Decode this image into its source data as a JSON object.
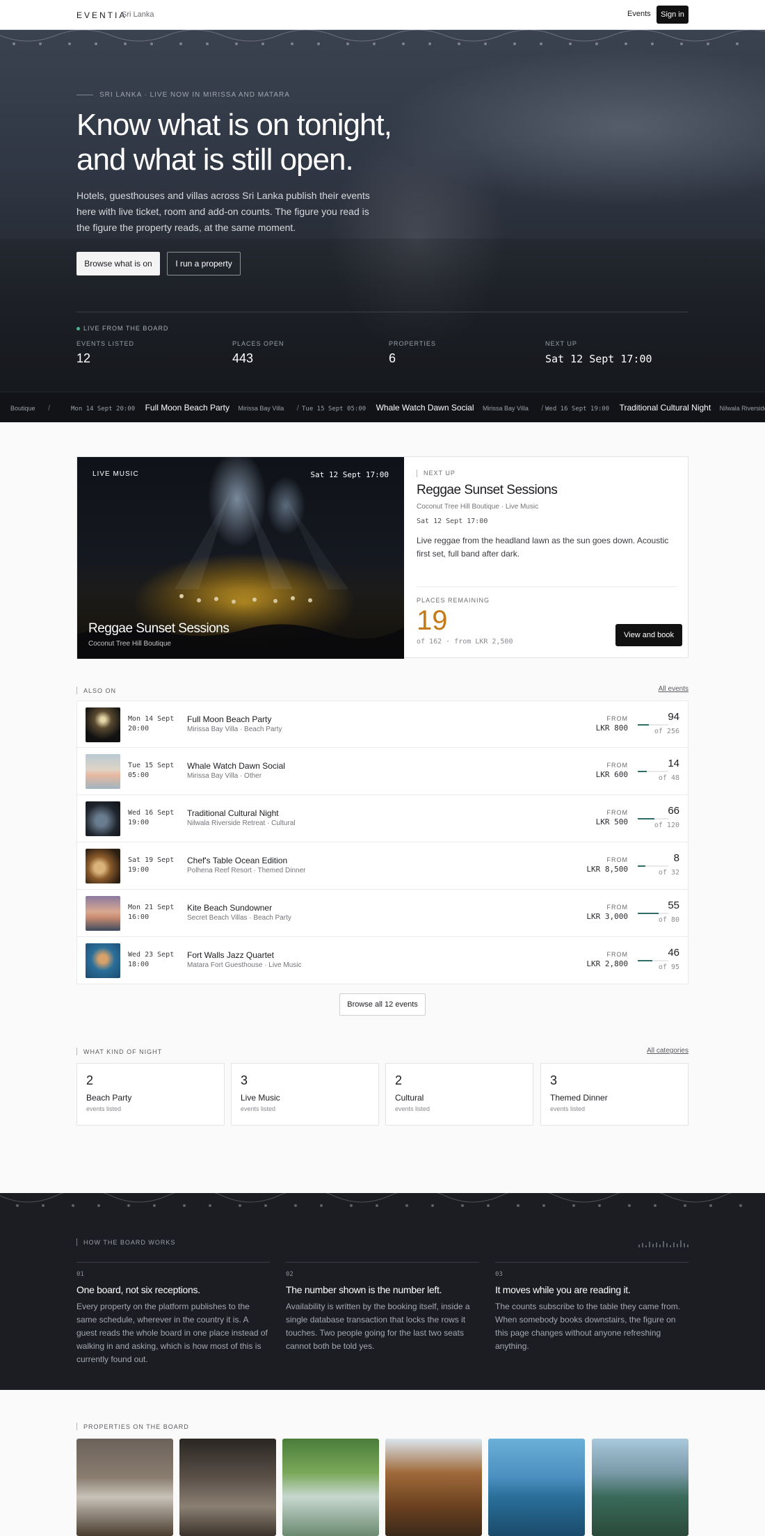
{
  "nav": {
    "brand": "EVENTIA",
    "brand_sub": "Sri Lanka",
    "events_link": "Events",
    "signin": "Sign in"
  },
  "hero": {
    "kicker": "SRI LANKA · LIVE NOW IN MIRISSA AND MATARA",
    "headline_line1": "Know what is on tonight,",
    "headline_line2": "and what is still open.",
    "lede": "Hotels, guesthouses and villas across Sri Lanka publish their events here with live ticket, room and add-on counts. The figure you read is the figure the property reads, at the same moment.",
    "primary_cta": "Browse what is on",
    "secondary_cta": "I run a property",
    "live_label": "LIVE FROM THE BOARD",
    "stats": [
      {
        "label": "EVENTS LISTED",
        "value": "12"
      },
      {
        "label": "PLACES OPEN",
        "value": "443"
      },
      {
        "label": "PROPERTIES",
        "value": "6"
      },
      {
        "label": "NEXT UP",
        "value": "Sat 12 Sept 17:00"
      }
    ],
    "ticker": [
      {
        "date": "",
        "name": "",
        "venue": "Boutique"
      },
      {
        "date": "Mon 14 Sept 20:00",
        "name": "Full Moon Beach Party",
        "venue": "Mirissa Bay Villa"
      },
      {
        "date": "Tue 15 Sept 05:00",
        "name": "Whale Watch Dawn Social",
        "venue": "Mirissa Bay Villa"
      },
      {
        "date": "Wed 16 Sept 19:00",
        "name": "Traditional Cultural Night",
        "venue": "Nilwala Riverside"
      }
    ]
  },
  "feature": {
    "tag": "LIVE MUSIC",
    "photo_time": "Sat 12 Sept 17:00",
    "photo_title": "Reggae Sunset Sessions",
    "photo_sub": "Coconut Tree Hill Boutique",
    "next_label": "NEXT UP",
    "title": "Reggae Sunset Sessions",
    "subtitle": "Coconut Tree Hill Boutique · Live Music",
    "time": "Sat 12 Sept 17:00",
    "description": "Live reggae from the headland lawn as the sun goes down. Acoustic first set, full band after dark.",
    "places_label": "PLACES REMAINING",
    "places_value": "19",
    "places_detail": "of 162 · from LKR 2,500",
    "book": "View and book"
  },
  "also_on": {
    "heading": "ALSO ON",
    "link": "All events",
    "rows": [
      {
        "day": "Mon 14 Sept",
        "time": "20:00",
        "name": "Full Moon Beach Party",
        "venue": "Mirissa Bay Villa · Beach Party",
        "from": "FROM",
        "price": "LKR 800",
        "left": "94",
        "of": "of 256",
        "fill": 0.37
      },
      {
        "day": "Tue 15 Sept",
        "time": "05:00",
        "name": "Whale Watch Dawn Social",
        "venue": "Mirissa Bay Villa · Other",
        "from": "FROM",
        "price": "LKR 600",
        "left": "14",
        "of": "of 48",
        "fill": 0.29
      },
      {
        "day": "Wed 16 Sept",
        "time": "19:00",
        "name": "Traditional Cultural Night",
        "venue": "Nilwala Riverside Retreat · Cultural",
        "from": "FROM",
        "price": "LKR 500",
        "left": "66",
        "of": "of 120",
        "fill": 0.55
      },
      {
        "day": "Sat 19 Sept",
        "time": "19:00",
        "name": "Chef's Table Ocean Edition",
        "venue": "Polhena Reef Resort · Themed Dinner",
        "from": "FROM",
        "price": "LKR 8,500",
        "left": "8",
        "of": "of 32",
        "fill": 0.25
      },
      {
        "day": "Mon 21 Sept",
        "time": "16:00",
        "name": "Kite Beach Sundowner",
        "venue": "Secret Beach Villas · Beach Party",
        "from": "FROM",
        "price": "LKR 3,000",
        "left": "55",
        "of": "of 80",
        "fill": 0.69
      },
      {
        "day": "Wed 23 Sept",
        "time": "18:00",
        "name": "Fort Walls Jazz Quartet",
        "venue": "Matara Fort Guesthouse · Live Music",
        "from": "FROM",
        "price": "LKR 2,800",
        "left": "46",
        "of": "of 95",
        "fill": 0.48
      }
    ],
    "browse_all": "Browse all 12 events"
  },
  "categories": {
    "heading": "WHAT KIND OF NIGHT",
    "link": "All categories",
    "items": [
      {
        "count": "2",
        "label": "Beach Party",
        "sub": "events listed"
      },
      {
        "count": "3",
        "label": "Live Music",
        "sub": "events listed"
      },
      {
        "count": "2",
        "label": "Cultural",
        "sub": "events listed"
      },
      {
        "count": "3",
        "label": "Themed Dinner",
        "sub": "events listed"
      }
    ]
  },
  "how": {
    "heading": "HOW THE BOARD WORKS",
    "steps": [
      {
        "num": "01",
        "title": "One board, not six receptions.",
        "body": "Every property on the platform publishes to the same schedule, wherever in the country it is. A guest reads the whole board in one place instead of walking in and asking, which is how most of this is currently found out."
      },
      {
        "num": "02",
        "title": "The number shown is the number left.",
        "body": "Availability is written by the booking itself, inside a single database transaction that locks the rows it touches. Two people going for the last two seats cannot both be told yes."
      },
      {
        "num": "03",
        "title": "It moves while you are reading it.",
        "body": "The counts subscribe to the table they came from. When somebody books downstairs, the figure on this page changes without anyone refreshing anything."
      }
    ]
  },
  "properties": {
    "heading": "PROPERTIES ON THE BOARD"
  },
  "colors": {
    "accent_orange": "#c67a17",
    "fill_green": "#2d6d66",
    "dark_bg": "#1b1d22",
    "live_dot": "#4fb08a"
  }
}
